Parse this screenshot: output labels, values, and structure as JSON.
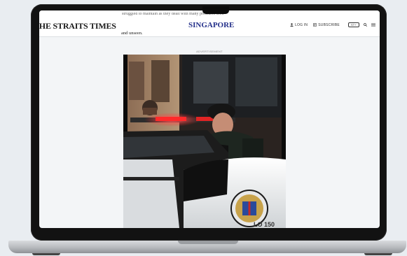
{
  "site": {
    "logo": "THE STRAITS TIMES",
    "section": "SINGAPORE",
    "peek_text": "struggled to maintain as they dealt with many pressures seen"
  },
  "nav": {
    "login": "LOG IN",
    "subscribe": "SUBSCRIBE",
    "edition": "ST+",
    "icons": [
      "user-icon",
      "newspaper-icon",
      "search-icon",
      "menu-icon"
    ]
  },
  "article": {
    "tail": "and unseen."
  },
  "advertisement": {
    "label": "ADVERTISEMENT",
    "badge_text": "LO 150",
    "colors": {
      "car_white": "#f2f2f2",
      "car_dark": "#1c1c1c",
      "siren_red": "#ff2a2a",
      "badge_blue": "#2b4a9b"
    }
  },
  "colors": {
    "section_accent": "#24308a",
    "page_bg": "#f3f5f7"
  }
}
